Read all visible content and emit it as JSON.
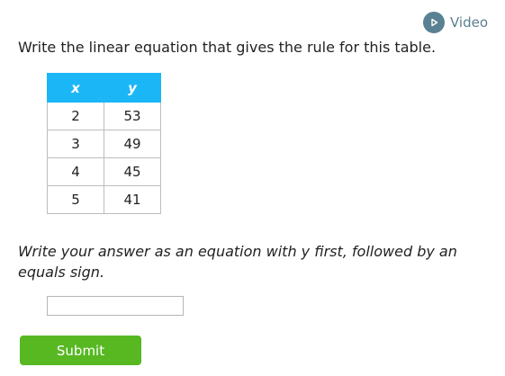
{
  "video": {
    "label": "Video",
    "icon": "play-icon",
    "icon_color": "#5a8193"
  },
  "question": "Write the linear equation that gives the rule for this table.",
  "table": {
    "headers": [
      "x",
      "y"
    ],
    "header_color": "#1bb6f5",
    "rows": [
      [
        "2",
        "53"
      ],
      [
        "3",
        "49"
      ],
      [
        "4",
        "45"
      ],
      [
        "5",
        "41"
      ]
    ]
  },
  "instructions": "Write your answer as an equation with y first, followed by an equals sign.",
  "answer": {
    "value": "",
    "placeholder": ""
  },
  "submit": {
    "label": "Submit",
    "color": "#57b822"
  }
}
